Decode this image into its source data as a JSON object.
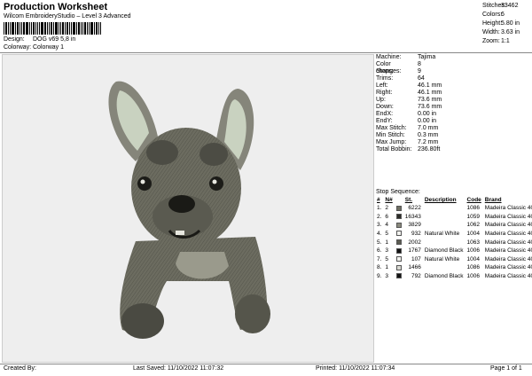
{
  "header": {
    "title": "Production Worksheet",
    "subtitle": "Wilcom EmbroideryStudio – Level 3 Advanced",
    "barcode_text": "DOG v69 5.8 in",
    "design_label": "Design:",
    "design_value": "DOG  v69 5,8 in",
    "colorway_label": "Colorway:",
    "colorway_value": "Colorway 1"
  },
  "summary": {
    "stitches_label": "Stitches:",
    "stitches": "33462",
    "colors_label": "Colors:",
    "colors": "6",
    "height_label": "Height:",
    "height": "5.80 in",
    "width_label": "Width:",
    "width": "3.63 in",
    "zoom_label": "Zoom:",
    "zoom": "1:1"
  },
  "machine_info": [
    {
      "k": "Machine:",
      "v": "Tajima"
    },
    {
      "k": "Color changes:",
      "v": "8"
    },
    {
      "k": "Stops:",
      "v": "9"
    },
    {
      "k": "Trims:",
      "v": "64"
    },
    {
      "k": "Left:",
      "v": "46.1 mm"
    },
    {
      "k": "Right:",
      "v": "46.1 mm"
    },
    {
      "k": "Up:",
      "v": "73.6 mm"
    },
    {
      "k": "Down:",
      "v": "73.6 mm"
    },
    {
      "k": "EndX:",
      "v": "0.00 in"
    },
    {
      "k": "EndY:",
      "v": "0.00 in"
    },
    {
      "k": "Max Stitch:",
      "v": "7.0 mm"
    },
    {
      "k": "Min Stitch:",
      "v": "0.3 mm"
    },
    {
      "k": "Max Jump:",
      "v": "7.2 mm"
    },
    {
      "k": "Total Bobbin:",
      "v": "236.80ft"
    }
  ],
  "stop_sequence": {
    "heading": "Stop Sequence:",
    "headers": [
      "#",
      "N#",
      "",
      "St.",
      "Description",
      "Code",
      "Brand"
    ],
    "rows": [
      {
        "n": "1.",
        "nn": "2",
        "color": "#6f6f63",
        "st": "6222",
        "desc": "",
        "code": "1086",
        "brand": "Madeira Classic 40"
      },
      {
        "n": "2.",
        "nn": "6",
        "color": "#2c2c28",
        "st": "16343",
        "desc": "",
        "code": "1059",
        "brand": "Madeira Classic 40"
      },
      {
        "n": "3.",
        "nn": "4",
        "color": "#8a8a7e",
        "st": "3829",
        "desc": "",
        "code": "1062",
        "brand": "Madeira Classic 40"
      },
      {
        "n": "4.",
        "nn": "5",
        "color": "#f2f2ee",
        "st": "932",
        "desc": "Natural White",
        "code": "1004",
        "brand": "Madeira Classic 40"
      },
      {
        "n": "5.",
        "nn": "1",
        "color": "#5c5c52",
        "st": "2002",
        "desc": "",
        "code": "1063",
        "brand": "Madeira Classic 40"
      },
      {
        "n": "6.",
        "nn": "3",
        "color": "#141414",
        "st": "1767",
        "desc": "Diamond Black",
        "code": "1006",
        "brand": "Madeira Classic 40"
      },
      {
        "n": "7.",
        "nn": "5",
        "color": "#f2f2ee",
        "st": "107",
        "desc": "Natural White",
        "code": "1004",
        "brand": "Madeira Classic 40"
      },
      {
        "n": "8.",
        "nn": "1",
        "color": "#d9d9d2",
        "st": "1466",
        "desc": "",
        "code": "1086",
        "brand": "Madeira Classic 40"
      },
      {
        "n": "9.",
        "nn": "3",
        "color": "#141414",
        "st": "792",
        "desc": "Diamond Black",
        "code": "1006",
        "brand": "Madeira Classic 40"
      }
    ]
  },
  "footer": {
    "created_by": "Created By:",
    "last_saved": "Last Saved: 11/10/2022 11:07:32",
    "printed": "Printed: 11/10/2022 11:07:34",
    "page": "Page 1 of 1"
  }
}
